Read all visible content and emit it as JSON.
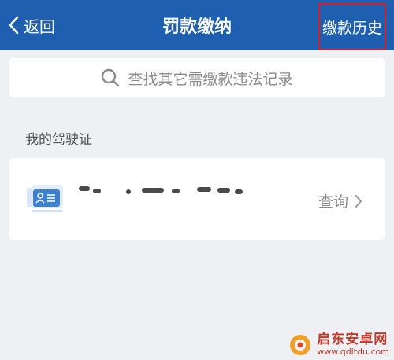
{
  "navbar": {
    "back_label": "返回",
    "title": "罚款缴纳",
    "history_label": "缴款历史",
    "background": "#1f5fb0"
  },
  "search": {
    "placeholder": "查找其它需缴款违法记录"
  },
  "license_section": {
    "label": "我的驾驶证",
    "card": {
      "icon": "driver-license-icon",
      "action_label": "查询"
    }
  },
  "watermark": {
    "cn": "启东安卓网",
    "url": "www.qdltdu.com"
  },
  "colors": {
    "accent": "#1f5fb0",
    "highlight_box": "#d0202a"
  }
}
